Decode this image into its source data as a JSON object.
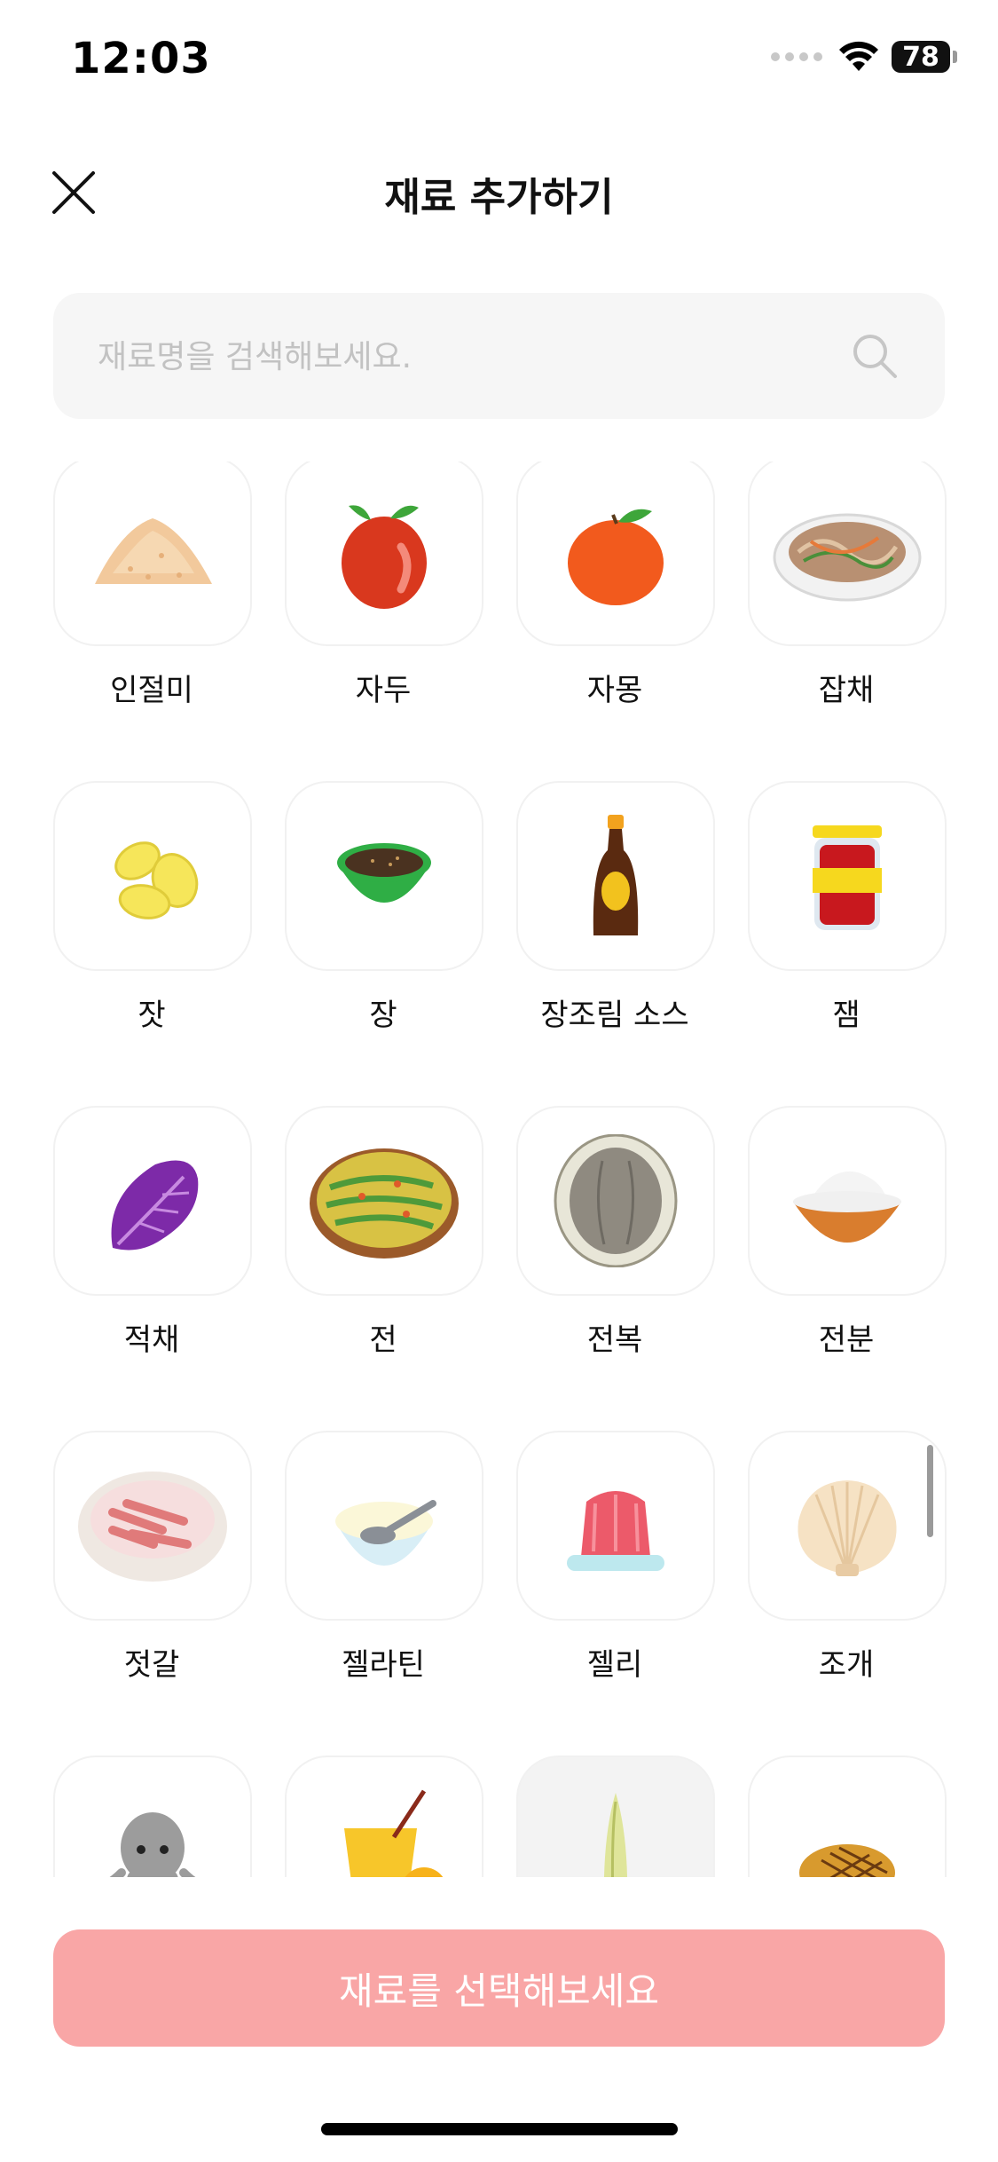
{
  "status_bar": {
    "time": "12:03",
    "battery": "78"
  },
  "header": {
    "title": "재료 추가하기",
    "close_icon": "close-icon"
  },
  "search": {
    "placeholder": "재료명을 검색해보세요.",
    "value": "",
    "icon": "search-icon"
  },
  "ingredients": [
    {
      "label": "인절미",
      "icon": "injeolmi-icon"
    },
    {
      "label": "자두",
      "icon": "plum-icon"
    },
    {
      "label": "자몽",
      "icon": "grapefruit-icon"
    },
    {
      "label": "잡채",
      "icon": "japchae-icon"
    },
    {
      "label": "잣",
      "icon": "pine-nut-icon"
    },
    {
      "label": "장",
      "icon": "sauce-bowl-icon"
    },
    {
      "label": "장조림 소스",
      "icon": "sauce-bottle-icon"
    },
    {
      "label": "잼",
      "icon": "jam-jar-icon"
    },
    {
      "label": "적채",
      "icon": "red-cabbage-icon"
    },
    {
      "label": "전",
      "icon": "pancake-icon"
    },
    {
      "label": "전복",
      "icon": "abalone-icon"
    },
    {
      "label": "전분",
      "icon": "starch-bowl-icon"
    },
    {
      "label": "젓갈",
      "icon": "salted-seafood-icon"
    },
    {
      "label": "젤라틴",
      "icon": "gelatin-icon"
    },
    {
      "label": "젤리",
      "icon": "jelly-icon"
    },
    {
      "label": "조개",
      "icon": "clam-icon"
    },
    {
      "label": "",
      "icon": "octopus-icon"
    },
    {
      "label": "",
      "icon": "juice-icon"
    },
    {
      "label": "",
      "icon": "bamboo-shoot-icon"
    },
    {
      "label": "",
      "icon": "croaker-icon"
    }
  ],
  "cta": {
    "label": "재료를 선택해보세요"
  },
  "colors": {
    "cta_background": "#f9a6a6",
    "search_background": "#f6f6f6",
    "tile_border": "#f1f1f1"
  }
}
